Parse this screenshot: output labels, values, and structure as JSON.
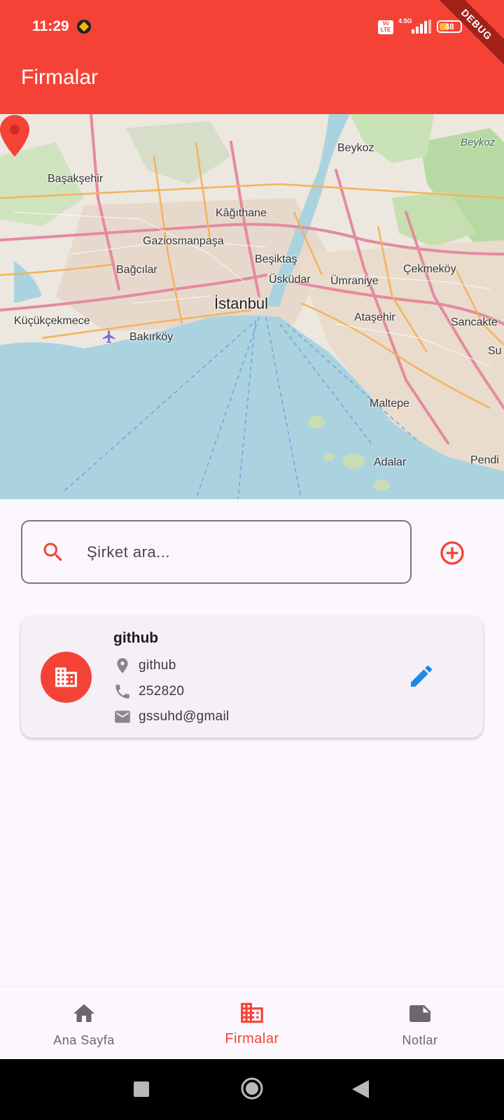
{
  "status_bar": {
    "time": "11:29",
    "volte": "Vo LTE",
    "network": "4.5G",
    "battery": "48",
    "battery_level": 0.48,
    "debug_banner": "DEBUG"
  },
  "app_bar": {
    "title": "Firmalar"
  },
  "map": {
    "labels": {
      "beykoz": "Beykoz",
      "beykoz_forest": "Beykoz",
      "basaksehir": "Başakşehir",
      "kagithane": "Kâğıthane",
      "gaziosmanpasa": "Gaziosmanpaşa",
      "besiktas": "Beşiktaş",
      "uskudar": "Üsküdar",
      "umraniye": "Ümraniye",
      "cekmekoy": "Çekmeköy",
      "bagcilar": "Bağcılar",
      "istanbul": "İstanbul",
      "kucukcekmece": "Küçükçekmece",
      "bakirkoy": "Bakırköy",
      "atasehir": "Ataşehir",
      "sancaktepe": "Sancakte",
      "sultanbeyli": "Su",
      "maltepe": "Maltepe",
      "adalar": "Adalar",
      "pendik": "Pendi"
    },
    "marker_icon": "location-pin-icon",
    "airport_icon": "airplane-icon"
  },
  "search": {
    "placeholder": "Şirket ara...",
    "value": "",
    "icon": "search-icon",
    "add_icon": "add-circle-icon"
  },
  "companies": [
    {
      "name": "github",
      "address": "github",
      "phone": "252820",
      "email": "gssuhd@gmail",
      "avatar_icon": "building-icon",
      "edit_icon": "edit-icon"
    }
  ],
  "bottom_nav": {
    "items": [
      {
        "label": "Ana Sayfa",
        "icon": "home-icon",
        "active": false
      },
      {
        "label": "Firmalar",
        "icon": "building-icon",
        "active": true
      },
      {
        "label": "Notlar",
        "icon": "note-icon",
        "active": false
      }
    ]
  },
  "colors": {
    "primary": "#f44336",
    "edit": "#1e88e5",
    "background": "#fcf7fd",
    "card": "#f4f0f6"
  }
}
